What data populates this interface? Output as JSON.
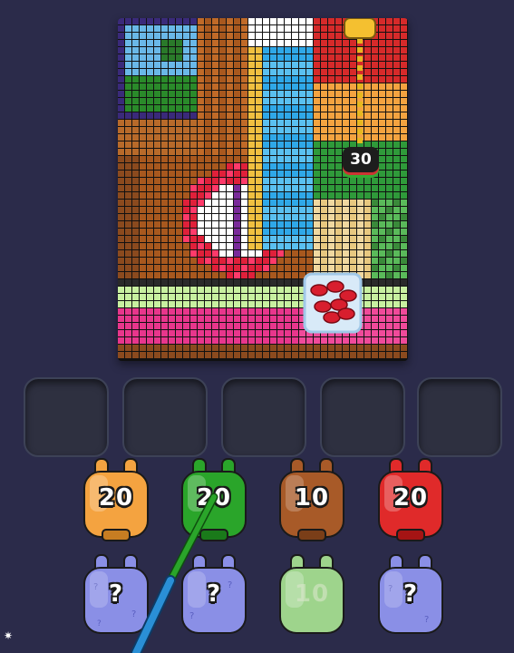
{
  "board": {
    "scene": "pixel-art",
    "chain_lock_count": "30",
    "ice_block": "jelly-bean-ice-block"
  },
  "slots": [
    {
      "state": "empty"
    },
    {
      "state": "empty"
    },
    {
      "state": "empty"
    },
    {
      "state": "empty"
    },
    {
      "state": "empty"
    }
  ],
  "jars": [
    {
      "label": "20",
      "color": "#f4a340"
    },
    {
      "label": "20",
      "color": "#2aa52a"
    },
    {
      "label": "10",
      "color": "#a85a28"
    },
    {
      "label": "20",
      "color": "#e02a2a"
    },
    {
      "label": "?",
      "color": "#8a8fe6"
    },
    {
      "label": "?",
      "color": "#8a8fe6"
    },
    {
      "label": "10",
      "color": "#9ed48c"
    },
    {
      "label": "?",
      "color": "#8a8fe6"
    }
  ],
  "colors": {
    "background": "#2b2b4a",
    "slot": "#2e3040",
    "chain": "#e6b820",
    "pointer": "#2a8fd6"
  },
  "icons": {
    "corner": "sparkle-icon",
    "hook": "chain-lock-icon"
  }
}
